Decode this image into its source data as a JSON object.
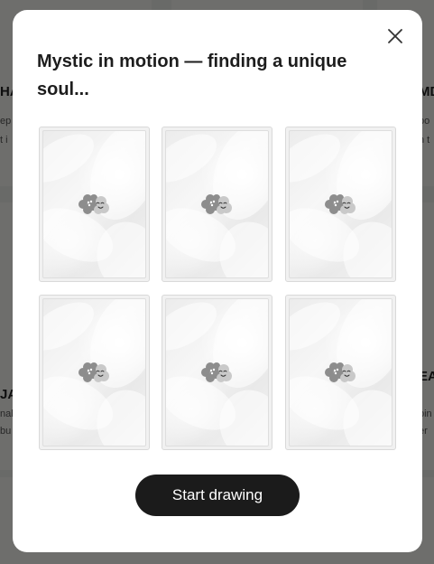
{
  "background": {
    "cards": [
      {
        "title": "HA",
        "lines": [
          "ep",
          "t i"
        ]
      },
      {
        "title": "MD",
        "lines": [
          "po",
          "n t"
        ]
      },
      {
        "title": "JA",
        "lines": [
          "nak",
          "bu"
        ]
      },
      {
        "title": "EA",
        "lines": [
          "bin",
          "er"
        ]
      }
    ]
  },
  "modal": {
    "title": "Mystic in motion — finding a unique soul...",
    "close_icon": "close-icon",
    "slots": [
      {
        "icon": "mascot-loading-icon"
      },
      {
        "icon": "mascot-loading-icon"
      },
      {
        "icon": "mascot-loading-icon"
      },
      {
        "icon": "mascot-loading-icon"
      },
      {
        "icon": "mascot-loading-icon"
      },
      {
        "icon": "mascot-loading-icon"
      }
    ],
    "start_button_label": "Start drawing"
  },
  "colors": {
    "button_bg": "#1b1b1b",
    "button_text": "#ffffff",
    "modal_bg": "#ffffff",
    "overlay": "rgba(0,0,0,0.55)"
  }
}
